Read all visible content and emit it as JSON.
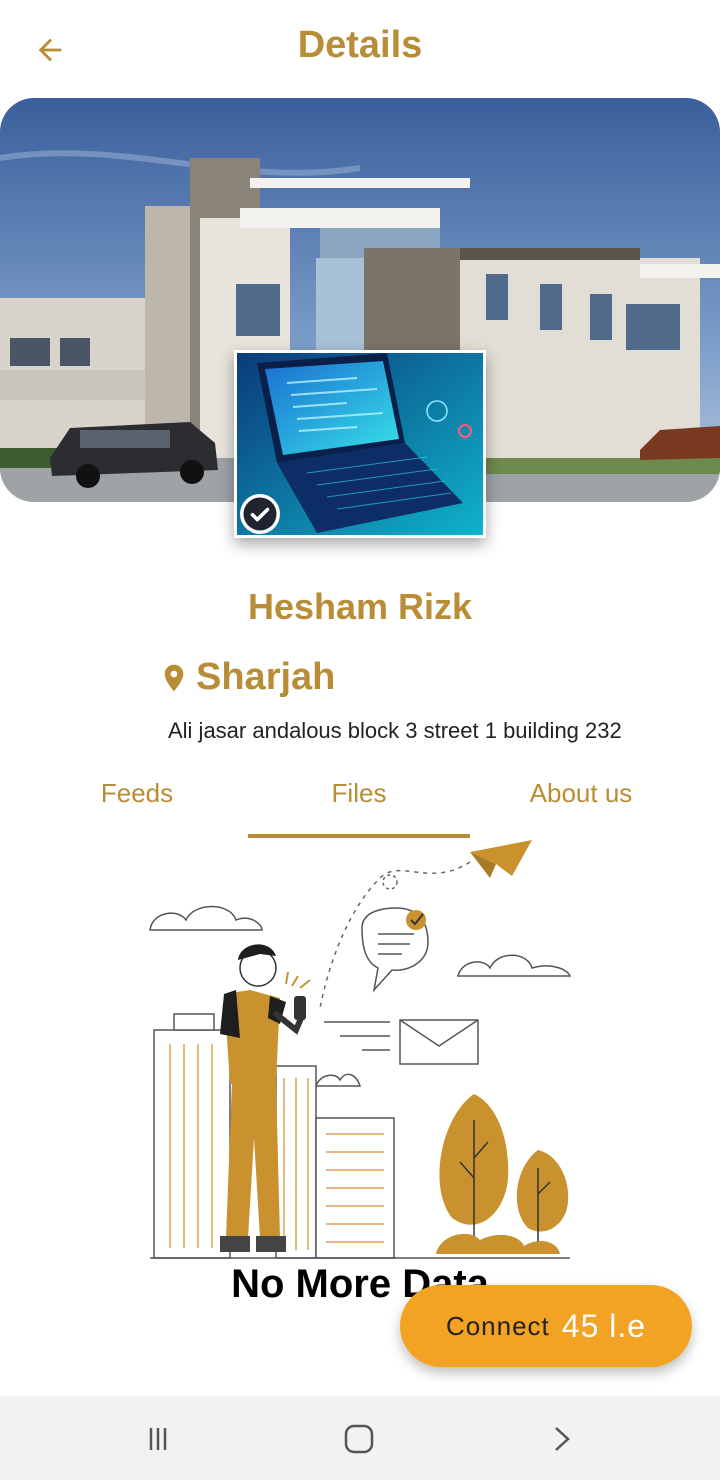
{
  "header": {
    "title": "Details",
    "back_icon": "arrow-left-icon"
  },
  "profile": {
    "name": "Hesham Rizk",
    "city": "Sharjah",
    "address": "Ali jasar andalous block 3 street 1 building 232",
    "verified": true
  },
  "tabs": [
    {
      "label": "Feeds",
      "active": false
    },
    {
      "label": "Files",
      "active": true
    },
    {
      "label": "About us",
      "active": false
    }
  ],
  "empty_state": {
    "message": "No More Data"
  },
  "connect": {
    "label": "Connect",
    "price": "45 l.e"
  },
  "nav": {
    "items": [
      "recent-apps-icon",
      "home-icon",
      "back-chevron-icon"
    ]
  },
  "colors": {
    "accent": "#b98d36",
    "button": "#f2a324",
    "nav_bg": "#f2f2f2"
  }
}
